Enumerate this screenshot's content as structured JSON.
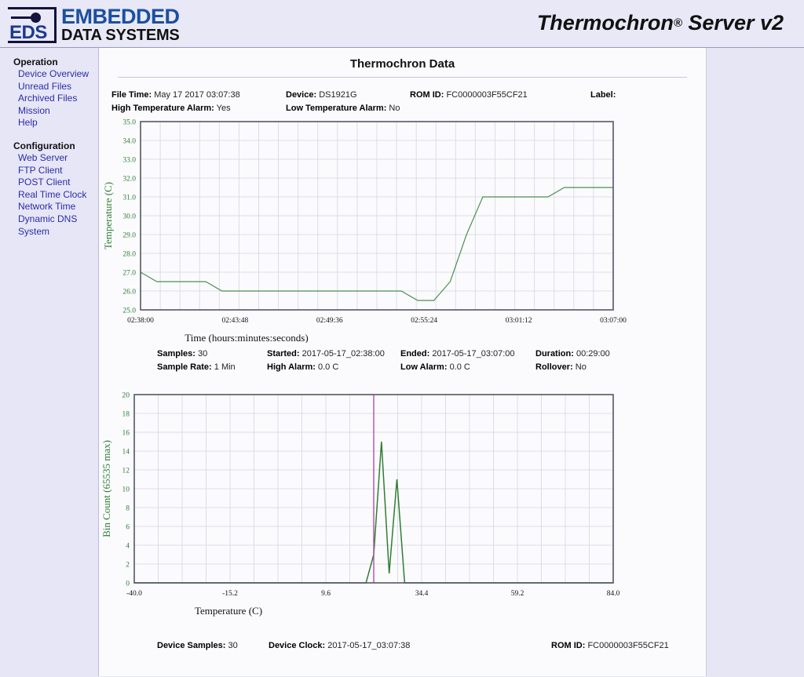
{
  "header": {
    "logo_eds": "EDS",
    "logo_line1": "EMBEDDED",
    "logo_line2": "DATA SYSTEMS",
    "app_title": "Thermochron",
    "app_title_reg": "®",
    "app_title_tail": " Server v2"
  },
  "sidebar": {
    "groups": [
      {
        "title": "Operation",
        "items": [
          {
            "label": "Device Overview"
          },
          {
            "label": "Unread Files"
          },
          {
            "label": "Archived Files"
          },
          {
            "label": "Mission"
          },
          {
            "label": "Help"
          }
        ]
      },
      {
        "title": "Configuration",
        "items": [
          {
            "label": "Web Server"
          },
          {
            "label": "FTP Client"
          },
          {
            "label": "POST Client"
          },
          {
            "label": "Real Time Clock"
          },
          {
            "label": "Network Time"
          },
          {
            "label": "Dynamic DNS"
          },
          {
            "label": "System"
          }
        ]
      }
    ]
  },
  "page": {
    "title": "Thermochron Data"
  },
  "file_meta": {
    "file_time_label": "File Time:",
    "file_time_value": "May 17 2017 03:07:38",
    "device_label": "Device:",
    "device_value": "DS1921G",
    "rom_id_label": "ROM ID:",
    "rom_id_value": "FC0000003F55CF21",
    "label_label": "Label:",
    "label_value": "",
    "high_alarm_label": "High Temperature Alarm:",
    "high_alarm_value": "Yes",
    "low_alarm_label": "Low Temperature Alarm:",
    "low_alarm_value": "No"
  },
  "mission_meta": {
    "samples_label": "Samples:",
    "samples_value": "30",
    "started_label": "Started:",
    "started_value": "2017-05-17_02:38:00",
    "ended_label": "Ended:",
    "ended_value": "2017-05-17_03:07:00",
    "duration_label": "Duration:",
    "duration_value": "00:29:00",
    "sample_rate_label": "Sample Rate:",
    "sample_rate_value": "1 Min",
    "high_alarm_label": "High Alarm:",
    "high_alarm_value": "0.0 C",
    "low_alarm_label": "Low Alarm:",
    "low_alarm_value": "0.0 C",
    "rollover_label": "Rollover:",
    "rollover_value": "No"
  },
  "device_meta": {
    "device_samples_label": "Device Samples:",
    "device_samples_value": "30",
    "device_clock_label": "Device Clock:",
    "device_clock_value": "2017-05-17_03:07:38",
    "rom_id_label": "ROM ID:",
    "rom_id_value": "FC0000003F55CF21"
  },
  "colors": {
    "line": "#2f7d32",
    "axis_label": "#2f7d32",
    "marker_line": "#b24cb2",
    "frame": "#555566",
    "grid": "#dcdce6",
    "nav_link": "#2c2ca8",
    "header_bg": "#e8e8f7"
  },
  "chart_data": [
    {
      "type": "line",
      "title": "Thermochron Data",
      "xlabel": "Time (hours:minutes:seconds)",
      "ylabel": "Temperature (C)",
      "ylim": [
        25.0,
        35.0
      ],
      "yticks": [
        "25.0",
        "26.0",
        "27.0",
        "28.0",
        "29.0",
        "30.0",
        "31.0",
        "32.0",
        "33.0",
        "34.0",
        "35.0"
      ],
      "xticks": [
        "02:38:00",
        "02:43:48",
        "02:49:36",
        "02:55:24",
        "03:01:12",
        "03:07:00"
      ],
      "xlim_minutes": [
        0,
        29
      ],
      "grid": true,
      "legend": "none",
      "x": [
        0,
        1,
        2,
        3,
        4,
        5,
        6,
        7,
        8,
        9,
        10,
        11,
        12,
        13,
        14,
        15,
        16,
        17,
        18,
        19,
        20,
        21,
        22,
        23,
        24,
        25,
        26,
        27,
        28,
        29
      ],
      "values": [
        27.0,
        26.5,
        26.5,
        26.5,
        26.5,
        26.0,
        26.0,
        26.0,
        26.0,
        26.0,
        26.0,
        26.0,
        26.0,
        26.0,
        26.0,
        26.0,
        26.0,
        25.5,
        25.5,
        26.5,
        29.0,
        31.0,
        31.0,
        31.0,
        31.0,
        31.0,
        31.5,
        31.5,
        31.5,
        31.5
      ]
    },
    {
      "type": "line",
      "title": "",
      "xlabel": "Temperature (C)",
      "ylabel": "Bin Count (65535 max)",
      "ylim": [
        0,
        20
      ],
      "yticks": [
        "0",
        "2",
        "4",
        "6",
        "8",
        "10",
        "12",
        "14",
        "16",
        "18",
        "20"
      ],
      "xticks": [
        "-40.0",
        "-15.2",
        "9.6",
        "34.4",
        "59.2",
        "84.0"
      ],
      "xlim": [
        -40.0,
        84.0
      ],
      "grid": true,
      "legend": "none",
      "marker_x": 22.0,
      "x": [
        18.0,
        20.0,
        22.0,
        24.0,
        26.0,
        28.0,
        30.0,
        32.0
      ],
      "values": [
        0,
        0,
        3,
        15,
        1,
        11,
        0,
        0
      ]
    }
  ]
}
